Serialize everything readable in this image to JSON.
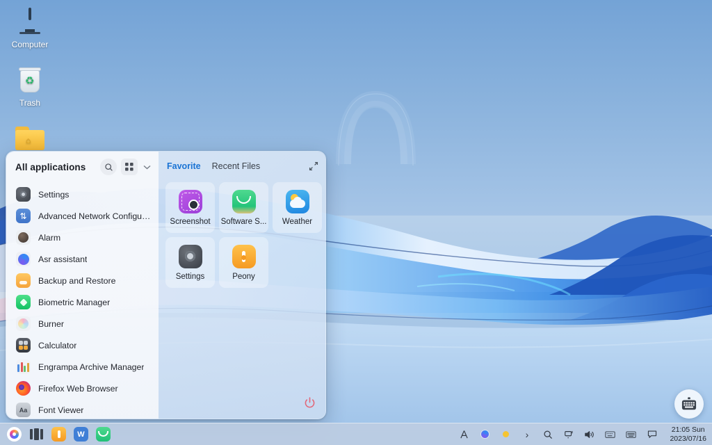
{
  "desktop": {
    "icons": [
      {
        "name": "computer",
        "label": "Computer"
      },
      {
        "name": "trash",
        "label": "Trash"
      },
      {
        "name": "home-folder",
        "label": ""
      }
    ]
  },
  "start_menu": {
    "left": {
      "title": "All applications",
      "search_icon": "search-icon",
      "grid_icon": "grid-view-icon",
      "chevron_icon": "chevron-down-icon",
      "apps": [
        {
          "label": "Settings",
          "icon": "settings-icon"
        },
        {
          "label": "Advanced Network Configura...",
          "icon": "network-transfer-icon"
        },
        {
          "label": "Alarm",
          "icon": "alarm-icon"
        },
        {
          "label": "Asr assistant",
          "icon": "asr-assistant-icon"
        },
        {
          "label": "Backup and Restore",
          "icon": "backup-restore-icon"
        },
        {
          "label": "Biometric Manager",
          "icon": "biometric-icon"
        },
        {
          "label": "Burner",
          "icon": "burner-icon"
        },
        {
          "label": "Calculator",
          "icon": "calculator-icon"
        },
        {
          "label": "Engrampa Archive Manager",
          "icon": "archive-icon"
        },
        {
          "label": "Firefox Web Browser",
          "icon": "firefox-icon"
        },
        {
          "label": "Font Viewer",
          "icon": "font-viewer-icon"
        }
      ]
    },
    "right": {
      "tabs": [
        {
          "label": "Favorite",
          "active": true
        },
        {
          "label": "Recent Files",
          "active": false
        }
      ],
      "expand_icon": "expand-icon",
      "favorites": [
        {
          "label": "Screenshot",
          "icon": "screenshot-icon"
        },
        {
          "label": "Software S...",
          "icon": "software-store-icon"
        },
        {
          "label": "Weather",
          "icon": "weather-icon"
        },
        {
          "label": "Settings",
          "icon": "settings-icon"
        },
        {
          "label": "Peony",
          "icon": "peony-icon"
        }
      ],
      "power_icon": "power-icon",
      "power_color": "#e2687a"
    }
  },
  "taskbar": {
    "pinned": [
      {
        "name": "start-button",
        "icon": "start-icon"
      },
      {
        "name": "task-view-button",
        "icon": "task-view-icon"
      },
      {
        "name": "peony-button",
        "icon": "peony-icon"
      },
      {
        "name": "wps-office-button",
        "icon": "wps-icon",
        "label": "W"
      },
      {
        "name": "mail-button",
        "icon": "mail-icon"
      }
    ],
    "tray": [
      {
        "name": "tray-ime",
        "icon": "ime-icon",
        "glyph": "A"
      },
      {
        "name": "tray-assistant",
        "icon": "assistant-icon"
      },
      {
        "name": "tray-notice",
        "icon": "notice-dot-icon"
      },
      {
        "name": "tray-expand",
        "icon": "chevron-right-icon",
        "glyph": "›"
      },
      {
        "name": "tray-search",
        "icon": "search-icon"
      },
      {
        "name": "tray-network",
        "icon": "network-icon"
      },
      {
        "name": "tray-volume",
        "icon": "volume-icon"
      },
      {
        "name": "tray-keyboard",
        "icon": "keyboard-icon"
      },
      {
        "name": "tray-input-method",
        "icon": "input-panel-icon"
      },
      {
        "name": "tray-messages",
        "icon": "message-icon"
      }
    ],
    "clock": {
      "time": "21:05 Sun",
      "date": "2023/07/16"
    }
  },
  "widget": {
    "keyboard_icon": "virtual-keyboard-icon"
  }
}
